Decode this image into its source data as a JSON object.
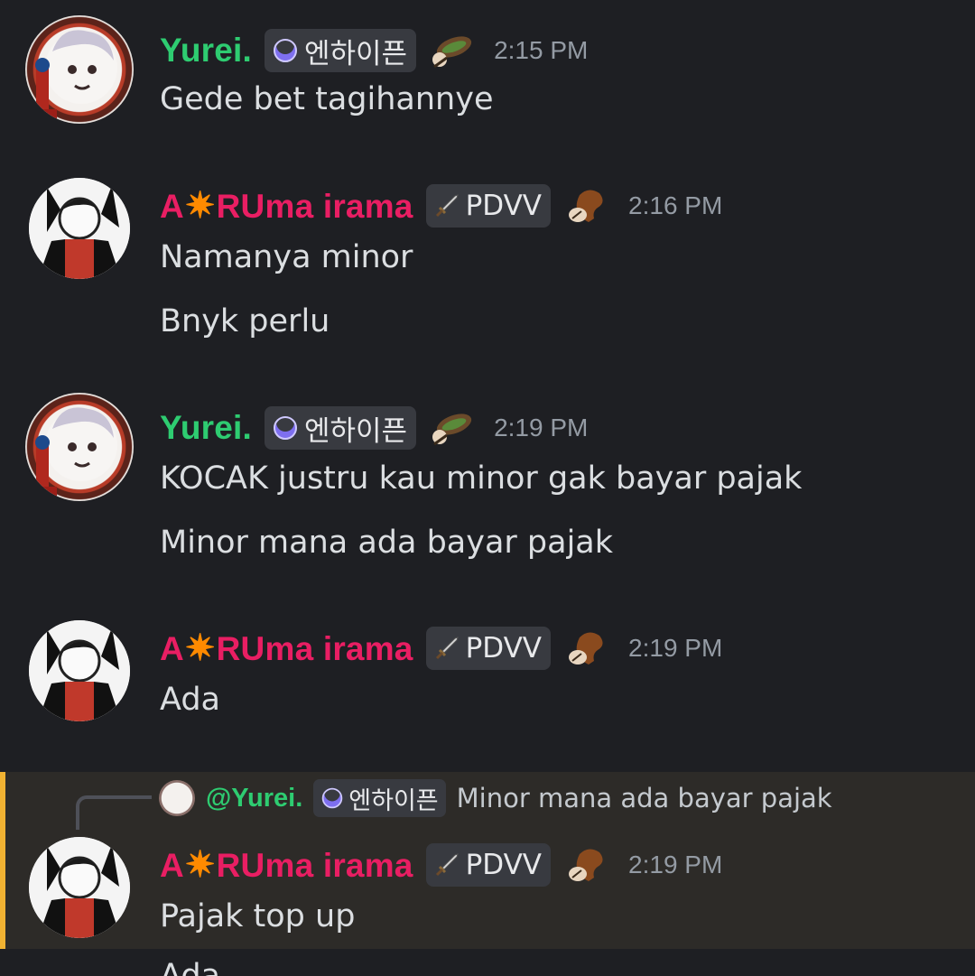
{
  "messages": [
    {
      "author": "Yurei.",
      "role_tag": "엔하이픈",
      "time": "2:15 PM",
      "lines": [
        "Gede bet tagihannye"
      ]
    },
    {
      "author_prefix": "A",
      "author_star": "✷",
      "author_suffix": "RUma irama",
      "role_tag": "PDVV",
      "time": "2:16 PM",
      "lines": [
        "Namanya minor",
        "Bnyk perlu"
      ]
    },
    {
      "author": "Yurei.",
      "role_tag": "엔하이픈",
      "time": "2:19 PM",
      "lines": [
        "KOCAK justru kau minor gak bayar pajak",
        "Minor mana ada bayar pajak"
      ]
    },
    {
      "author_prefix": "A",
      "author_star": "✷",
      "author_suffix": "RUma irama",
      "role_tag": "PDVV",
      "time": "2:19 PM",
      "lines": [
        "Ada"
      ]
    },
    {
      "reply": {
        "mention": "@Yurei.",
        "role_tag": "엔하이픈",
        "text": "Minor mana ada bayar pajak"
      },
      "author_prefix": "A",
      "author_star": "✷",
      "author_suffix": "RUma irama",
      "role_tag": "PDVV",
      "time": "2:19 PM",
      "lines": [
        "Pajak top up",
        "Ada"
      ]
    }
  ],
  "colors": {
    "background": "#1e1f23",
    "yurei_name": "#2ecc71",
    "aruma_name": "#e91e63",
    "reply_highlight": "#2d2b28",
    "reply_bar": "#f0b232",
    "timestamp": "#949ba4"
  },
  "icons": {
    "yurei_tag_icon": "crescent-moon-icon",
    "aruma_tag_icon": "sword-icon",
    "yurei_decoration": "leaf-creature-icon",
    "aruma_decoration": "squirrel-icon"
  }
}
